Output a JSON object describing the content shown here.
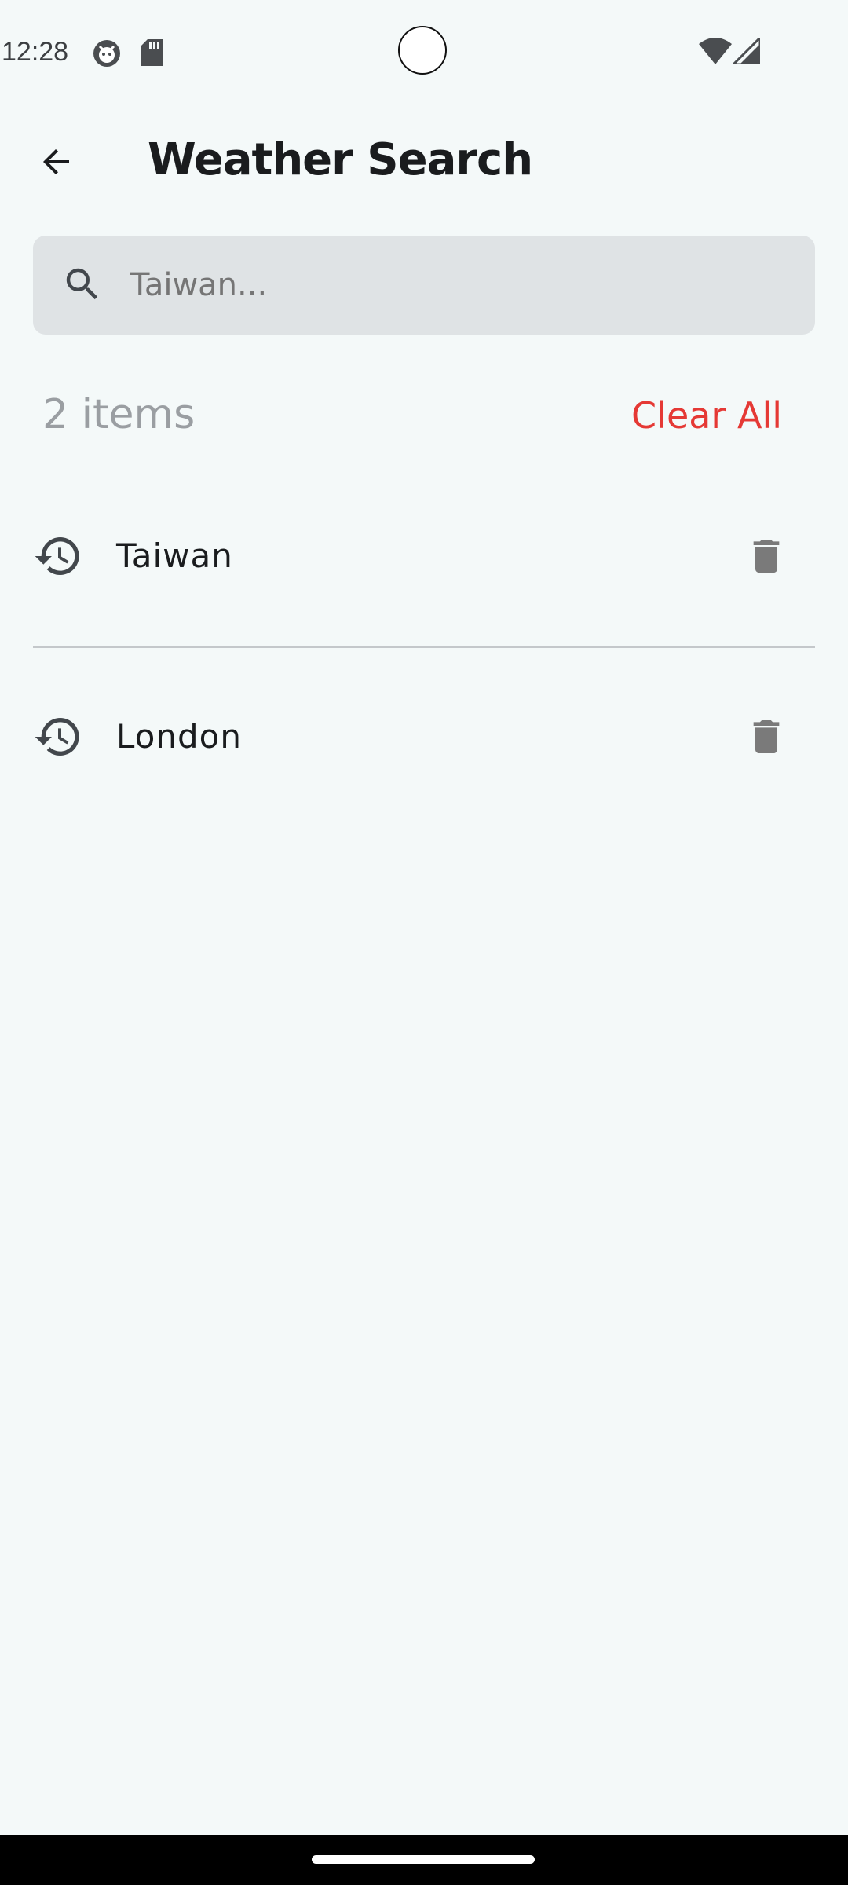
{
  "status_bar": {
    "time": "12:28",
    "icons": [
      "face-notification-icon",
      "sd-card-icon",
      "wifi-icon",
      "cellular-signal-icon"
    ]
  },
  "top_bar": {
    "back_icon": "arrow-back-icon",
    "title": "Weather Search"
  },
  "search": {
    "icon": "search-icon",
    "placeholder": "Taiwan..."
  },
  "history": {
    "count_label": "2 items",
    "clear_all_label": "Clear All",
    "items": [
      {
        "label": "Taiwan",
        "icon": "history-icon",
        "action_icon": "delete-icon"
      },
      {
        "label": "London",
        "icon": "history-icon",
        "action_icon": "delete-icon"
      }
    ]
  },
  "colors": {
    "background": "#f4f9f9",
    "search_background": "#dfe3e5",
    "accent_red": "#e53935",
    "muted_text": "#9a9ea2",
    "icon_gray": "#7a7a7a"
  }
}
